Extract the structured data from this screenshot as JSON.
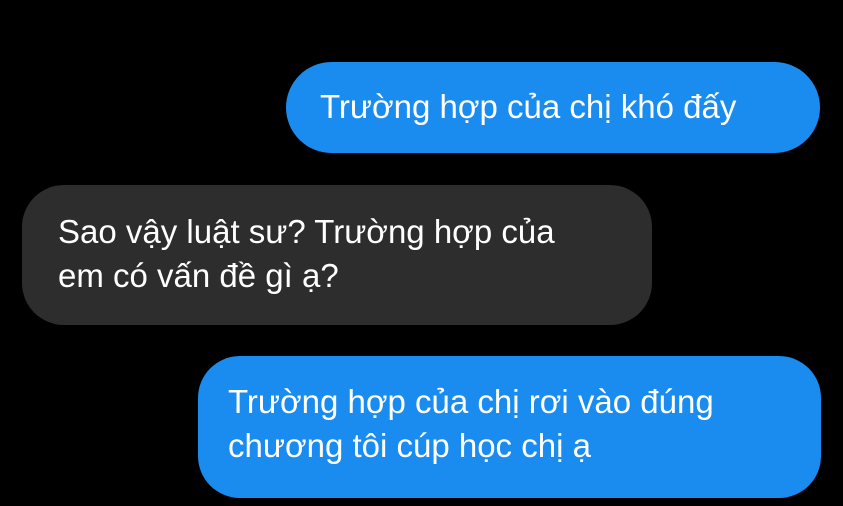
{
  "conversation": {
    "messages": [
      {
        "sender": "me",
        "text": "Trường hợp của chị khó đấy",
        "color": "#1a8cf0"
      },
      {
        "sender": "other",
        "text": "Sao vậy luật sư? Trường hợp của\nem có vấn đề gì ạ?",
        "color": "#2d2d2d"
      },
      {
        "sender": "me",
        "text": "Trường hợp của chị rơi vào đúng\nchương tôi cúp học chị ạ",
        "color": "#1a8cf0"
      }
    ]
  }
}
